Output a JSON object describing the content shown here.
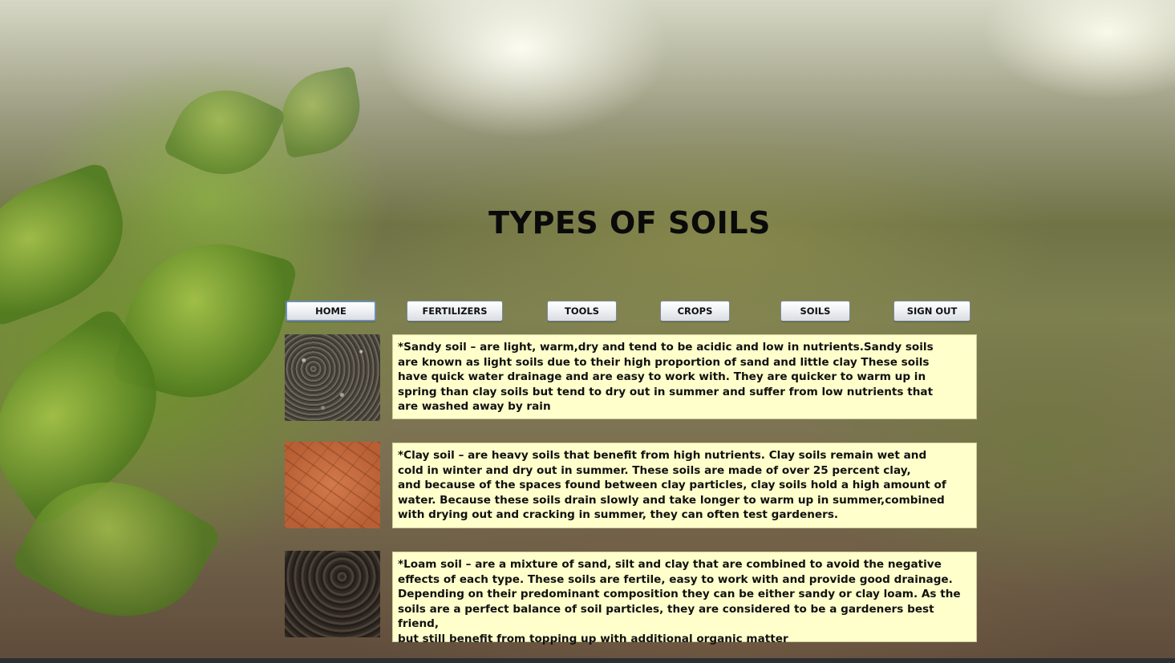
{
  "page": {
    "title": "TYPES OF SOILS"
  },
  "nav": {
    "home": "HOME",
    "fertilizers": "FERTILIZERS",
    "tools": "TOOLS",
    "crops": "CROPS",
    "soils": "SOILS",
    "sign_out": "SIGN OUT"
  },
  "soils": [
    {
      "name": "sandy",
      "image": "sandy-soil-image",
      "text": "*Sandy soil – are light, warm,dry and tend to be acidic and low in nutrients.Sandy soils\nare known as light soils due to their high proportion of sand and little clay  These soils\nhave quick water drainage and are easy to work with. They are quicker to warm up in\nspring than clay soils but tend to dry out in summer and suffer from low nutrients that\nare washed away by rain"
    },
    {
      "name": "clay",
      "image": "clay-soil-image",
      "text": "*Clay soil – are heavy soils that benefit from high nutrients. Clay soils remain wet and\ncold in winter and dry out in summer. These soils are made of over 25 percent clay,\nand because of the spaces found between clay particles, clay soils hold a high amount of\nwater. Because these soils drain slowly and take longer to warm up in summer,combined\nwith drying out and cracking in summer, they can often test gardeners."
    },
    {
      "name": "loam",
      "image": "loam-soil-image",
      "text": "*Loam soil – are a mixture of sand, silt and clay that are combined to avoid the negative\neffects of each type. These soils are fertile, easy to work with and provide good drainage.\nDepending on their predominant composition they can be either sandy or clay loam. As the\nsoils are a perfect balance of soil particles, they are considered to be a gardeners best friend,\nbut still benefit from topping up with additional organic matter"
    }
  ],
  "colors": {
    "panel_background": "#ffffcc",
    "active_button_border": "#6d8fb6"
  }
}
